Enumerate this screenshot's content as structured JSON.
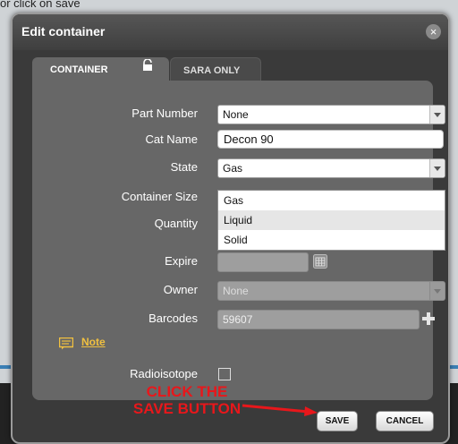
{
  "background": {
    "top_text": "or click on save"
  },
  "dialog": {
    "title": "Edit container",
    "close_glyph": "×",
    "tabs": [
      {
        "label": "CONTAINER",
        "active": true
      },
      {
        "label": "SARA ONLY",
        "active": false
      }
    ],
    "fields": {
      "part_number": {
        "label": "Part Number",
        "value": "None"
      },
      "cat_name": {
        "label": "Cat Name",
        "value": "Decon 90"
      },
      "state": {
        "label": "State",
        "value": "Gas",
        "options": [
          "Gas",
          "Liquid",
          "Solid"
        ],
        "hovered": "Liquid"
      },
      "container_size": {
        "label": "Container Size"
      },
      "quantity": {
        "label": "Quantity"
      },
      "expire": {
        "label": "Expire",
        "value": ""
      },
      "owner": {
        "label": "Owner",
        "value": "None"
      },
      "barcodes": {
        "label": "Barcodes",
        "value": "59607"
      },
      "radioisotope": {
        "label": "Radioisotope",
        "checked": false
      }
    },
    "note_label": "Note",
    "annotation": {
      "line1": "CLICK THE",
      "line2": "SAVE BUTTON",
      "color": "#e8171b"
    },
    "buttons": {
      "save": "SAVE",
      "cancel": "CANCEL"
    }
  },
  "icons": {
    "lock": "lock-icon",
    "calendar": "calendar-icon",
    "plus": "plus-icon",
    "note": "note-icon",
    "close": "close-icon",
    "dropdown": "chevron-down-icon"
  },
  "colors": {
    "dialog_bg": "#3a3a3a",
    "panel_bg": "#676767",
    "link": "#f0c040",
    "annotation": "#e8171b"
  }
}
